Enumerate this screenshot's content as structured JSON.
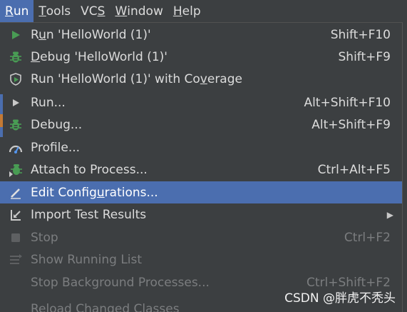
{
  "menubar": {
    "items": [
      {
        "pre": "",
        "u": "R",
        "post": "un"
      },
      {
        "pre": "",
        "u": "T",
        "post": "ools"
      },
      {
        "pre": "VC",
        "u": "S",
        "post": ""
      },
      {
        "pre": "",
        "u": "W",
        "post": "indow"
      },
      {
        "pre": "",
        "u": "H",
        "post": "elp"
      }
    ]
  },
  "menu": {
    "run": {
      "pre": "R",
      "u": "u",
      "post": "n 'HelloWorld (1)'",
      "shortcut": "Shift+F10"
    },
    "debug": {
      "pre": "",
      "u": "D",
      "post": "ebug 'HelloWorld (1)'",
      "shortcut": "Shift+F9"
    },
    "coverage": {
      "pre": "Run 'HelloWorld (1)' with Co",
      "u": "v",
      "post": "erage",
      "shortcut": ""
    },
    "run_dots": {
      "label": "Run...",
      "shortcut": "Alt+Shift+F10"
    },
    "debug_dots": {
      "label": "Debug...",
      "shortcut": "Alt+Shift+F9"
    },
    "profile": {
      "label": "Profile...",
      "shortcut": ""
    },
    "attach": {
      "label": "Attach to Process...",
      "shortcut": "Ctrl+Alt+F5"
    },
    "edit_config": {
      "pre": "Edit Config",
      "u": "u",
      "post": "rations...",
      "shortcut": ""
    },
    "import_results": {
      "label": "Import Test Results",
      "shortcut": ""
    },
    "stop": {
      "label": "Stop",
      "shortcut": "Ctrl+F2"
    },
    "show_running": {
      "label": "Show Running List",
      "shortcut": ""
    },
    "stop_background": {
      "label": "Stop Background Processes...",
      "shortcut": "Ctrl+Shift+F2"
    },
    "reload": {
      "label": "Reload Changed Classes",
      "shortcut": ""
    }
  },
  "watermark": "CSDN @胖虎不秃头",
  "colors": {
    "background": "#3c3f41",
    "highlight": "#4b6eaf",
    "text": "#dcdcdc",
    "disabled_text": "#7b7d7f",
    "run_green": "#499c54",
    "debug_green": "#499c54"
  }
}
